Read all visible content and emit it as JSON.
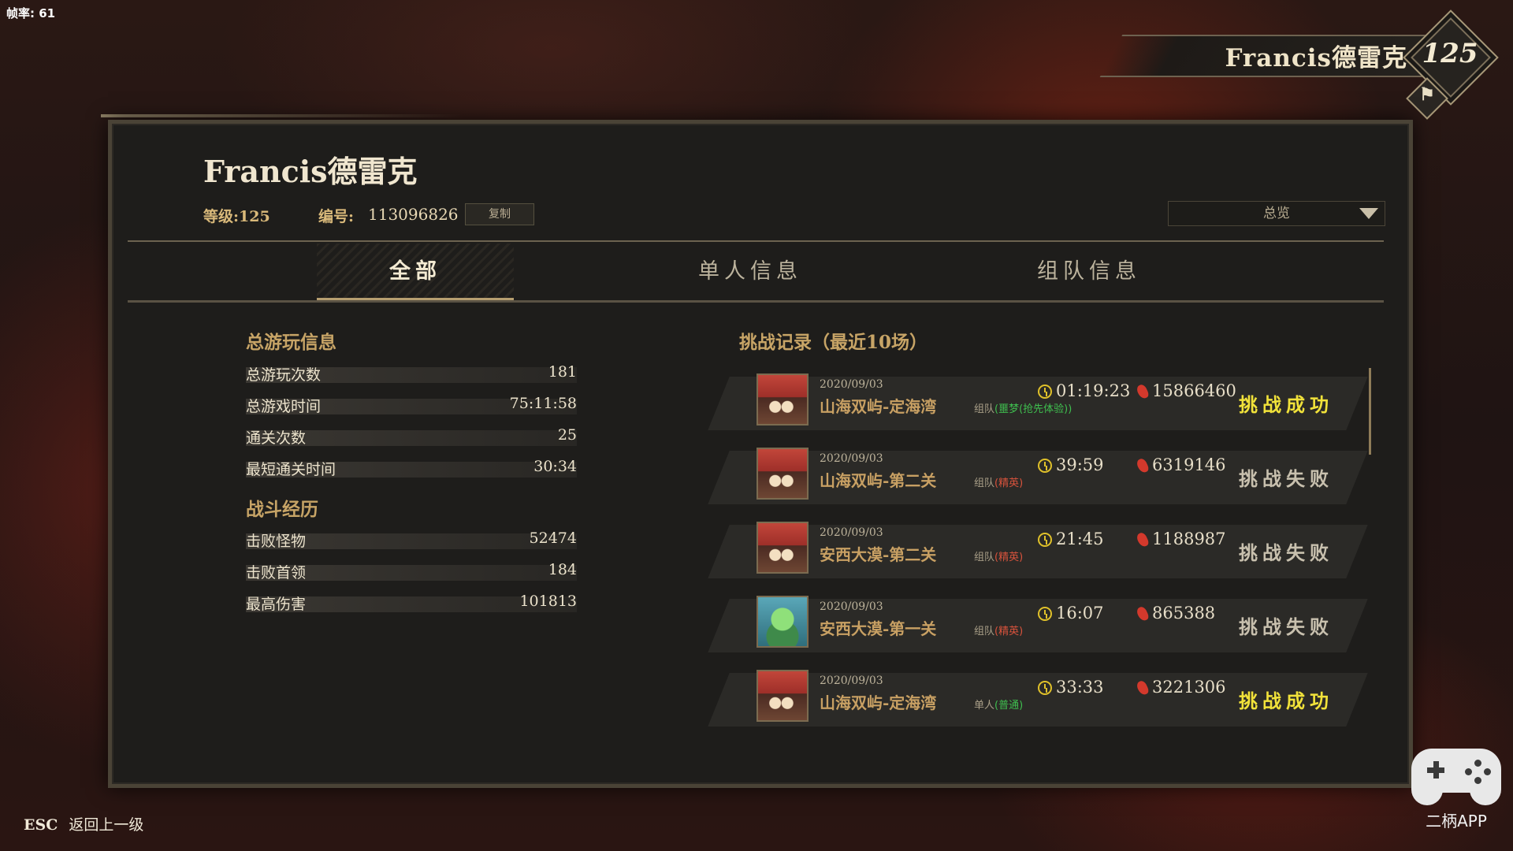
{
  "overlay": {
    "fps_label": "帧率: 61"
  },
  "badge": {
    "name": "Francis德雷克",
    "level": "125",
    "emblem_glyph": "⚑"
  },
  "profile": {
    "name": "Francis德雷克",
    "level_label": "等级:125",
    "id_label": "编号:",
    "id_value": "113096826",
    "copy_label": "复制",
    "view_select": "总览"
  },
  "tabs": [
    {
      "label": "全部",
      "active": true
    },
    {
      "label": "单人信息",
      "active": false
    },
    {
      "label": "组队信息",
      "active": false
    }
  ],
  "overall": {
    "title": "总游玩信息",
    "rows": [
      {
        "label": "总游玩次数",
        "value": "181"
      },
      {
        "label": "总游戏时间",
        "value": "75:11:58"
      },
      {
        "label": "通关次数",
        "value": "25"
      },
      {
        "label": "最短通关时间",
        "value": "30:34"
      }
    ]
  },
  "combat": {
    "title": "战斗经历",
    "rows": [
      {
        "label": "击败怪物",
        "value": "52474"
      },
      {
        "label": "击败首领",
        "value": "184"
      },
      {
        "label": "最高伤害",
        "value": "101813"
      }
    ]
  },
  "records": {
    "title": "挑战记录（最近10场）",
    "items": [
      {
        "date": "2020/09/03",
        "map": "山海双屿-定海湾",
        "mode": "组队",
        "difficulty": "(噩梦(抢先体验))",
        "difficulty_color": "green",
        "avatar": "red",
        "time": "01:19:23",
        "score": "15866460",
        "result": "挑战成功",
        "won": true
      },
      {
        "date": "2020/09/03",
        "map": "山海双屿-第二关",
        "mode": "组队",
        "difficulty": "(精英)",
        "difficulty_color": "red",
        "avatar": "red",
        "time": "39:59",
        "score": "6319146",
        "result": "挑战失败",
        "won": false
      },
      {
        "date": "2020/09/03",
        "map": "安西大漠-第二关",
        "mode": "组队",
        "difficulty": "(精英)",
        "difficulty_color": "red",
        "avatar": "red",
        "time": "21:45",
        "score": "1188987",
        "result": "挑战失败",
        "won": false
      },
      {
        "date": "2020/09/03",
        "map": "安西大漠-第一关",
        "mode": "组队",
        "difficulty": "(精英)",
        "difficulty_color": "red",
        "avatar": "green",
        "time": "16:07",
        "score": "865388",
        "result": "挑战失败",
        "won": false
      },
      {
        "date": "2020/09/03",
        "map": "山海双屿-定海湾",
        "mode": "单人",
        "difficulty": "(普通)",
        "difficulty_color": "green",
        "avatar": "red",
        "time": "33:33",
        "score": "3221306",
        "result": "挑战成功",
        "won": true
      }
    ]
  },
  "footer": {
    "esc_key": "ESC",
    "esc_label": "返回上一级",
    "app_name": "二柄APP"
  },
  "colors": {
    "accent_gold": "#c7a466",
    "win": "#f1e23a",
    "lose": "#c8c0ae",
    "panel": "#1e1d1b"
  }
}
